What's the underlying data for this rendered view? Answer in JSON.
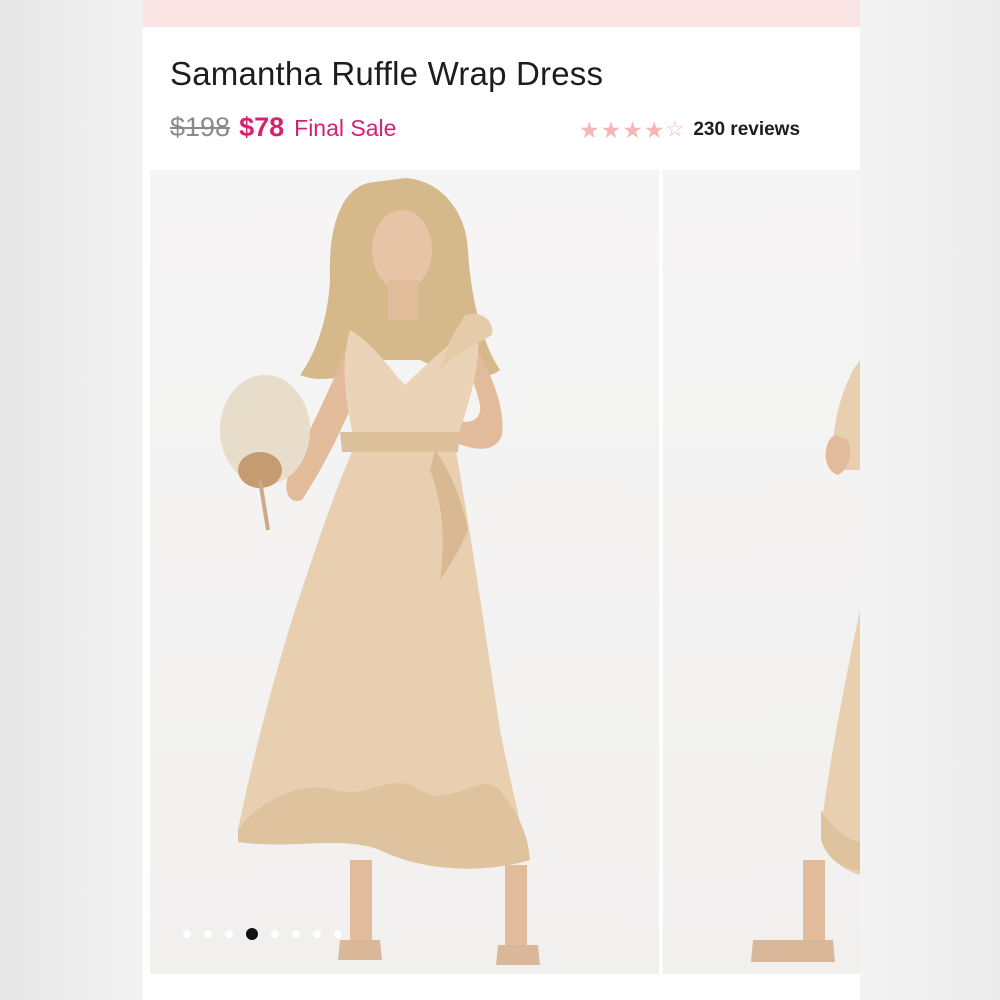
{
  "product": {
    "title": "Samantha Ruffle Wrap Dress",
    "original_price": "$198",
    "sale_price": "$78",
    "sale_label": "Final Sale",
    "rating": 4,
    "rating_max": 5,
    "reviews_label": "230 reviews"
  },
  "gallery": {
    "slide_count": 8,
    "active_index": 3
  },
  "colors": {
    "accent": "#d6216e",
    "star": "#f4b6b6",
    "promo_band": "#fbe4e4",
    "dress": "#e9d2b4"
  },
  "icons": {
    "star_full": "star-icon",
    "star_empty": "star-outline-icon"
  }
}
